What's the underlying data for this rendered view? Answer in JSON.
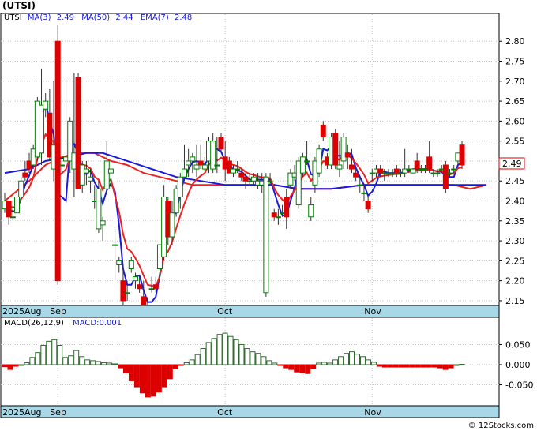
{
  "title": "(UTSI)",
  "watermark": "© 12Stocks.com",
  "legend": {
    "ticker": "UTSI",
    "ma3_label": "MA(3)",
    "ma3_value": "2.49",
    "ma50_label": "MA(50)",
    "ma50_value": "2.44",
    "ema7_label": "EMA(7)",
    "ema7_value": "2.48"
  },
  "last_price_label": "2.49",
  "macd_legend": {
    "label": "MACD(26,12,9)",
    "value_label": "MACD:0.001"
  },
  "x_labels": [
    {
      "text": "2025Aug",
      "index": 0
    },
    {
      "text": "Sep",
      "index": 13
    },
    {
      "text": "Oct",
      "index": 54
    },
    {
      "text": "Nov",
      "index": 90
    }
  ],
  "colors": {
    "up": "#008000",
    "down": "#dd0000",
    "ma_blue": "#1a1adf",
    "ma_red": "#ee2222",
    "axis_band": "#a8d8e8",
    "grid": "#c8c8c8",
    "macd_bar": "#2e6b2e"
  },
  "chart_data": {
    "type": "candlestick",
    "ylim": [
      2.14,
      2.84
    ],
    "y_ticks": [
      "2.80",
      "2.75",
      "2.70",
      "2.65",
      "2.60",
      "2.55",
      "2.50",
      "2.45",
      "2.40",
      "2.35",
      "2.30",
      "2.25",
      "2.20",
      "2.15"
    ],
    "ohlc": [
      [
        2.38,
        2.42,
        2.37,
        2.4
      ],
      [
        2.4,
        2.4,
        2.34,
        2.36
      ],
      [
        2.36,
        2.39,
        2.35,
        2.36
      ],
      [
        2.37,
        2.42,
        2.36,
        2.41
      ],
      [
        2.41,
        2.46,
        2.4,
        2.45
      ],
      [
        2.47,
        2.5,
        2.45,
        2.46
      ],
      [
        2.5,
        2.52,
        2.47,
        2.48
      ],
      [
        2.49,
        2.54,
        2.48,
        2.53
      ],
      [
        2.51,
        2.66,
        2.5,
        2.65
      ],
      [
        2.52,
        2.73,
        2.49,
        2.64
      ],
      [
        2.63,
        2.67,
        2.61,
        2.65
      ],
      [
        2.62,
        2.68,
        2.5,
        2.51
      ],
      [
        2.48,
        2.7,
        2.45,
        2.54
      ],
      [
        2.8,
        2.84,
        2.19,
        2.2
      ],
      [
        2.49,
        2.51,
        2.47,
        2.49
      ],
      [
        2.5,
        2.7,
        2.48,
        2.51
      ],
      [
        2.5,
        2.61,
        2.47,
        2.6
      ],
      [
        2.48,
        2.72,
        2.41,
        2.52
      ],
      [
        2.71,
        2.72,
        2.43,
        2.43
      ],
      [
        2.44,
        2.5,
        2.42,
        2.49
      ],
      [
        2.47,
        2.5,
        2.44,
        2.48
      ],
      [
        2.45,
        2.48,
        2.42,
        2.46
      ],
      [
        2.4,
        2.44,
        2.38,
        2.4
      ],
      [
        2.33,
        2.45,
        2.32,
        2.43
      ],
      [
        2.34,
        2.36,
        2.3,
        2.35
      ],
      [
        2.43,
        2.55,
        2.42,
        2.5
      ],
      [
        2.47,
        2.49,
        2.43,
        2.48
      ],
      [
        2.29,
        2.33,
        2.2,
        2.29
      ],
      [
        2.24,
        2.26,
        2.22,
        2.25
      ],
      [
        2.2,
        2.24,
        2.13,
        2.15
      ],
      [
        2.17,
        2.2,
        2.15,
        2.17
      ],
      [
        2.23,
        2.26,
        2.22,
        2.25
      ],
      [
        2.2,
        2.22,
        2.18,
        2.21
      ],
      [
        2.19,
        2.21,
        2.17,
        2.18
      ],
      [
        2.16,
        2.2,
        2.13,
        2.14
      ],
      [
        2.13,
        2.16,
        2.1,
        2.12
      ],
      [
        2.18,
        2.21,
        2.17,
        2.18
      ],
      [
        2.19,
        2.21,
        2.17,
        2.18
      ],
      [
        2.23,
        2.3,
        2.18,
        2.29
      ],
      [
        2.26,
        2.44,
        2.25,
        2.41
      ],
      [
        2.4,
        2.41,
        2.29,
        2.31
      ],
      [
        2.31,
        2.4,
        2.29,
        2.37
      ],
      [
        2.37,
        2.44,
        2.36,
        2.43
      ],
      [
        2.41,
        2.47,
        2.38,
        2.46
      ],
      [
        2.46,
        2.54,
        2.45,
        2.48
      ],
      [
        2.49,
        2.53,
        2.46,
        2.5
      ],
      [
        2.5,
        2.52,
        2.47,
        2.51
      ],
      [
        2.48,
        2.54,
        2.46,
        2.49
      ],
      [
        2.5,
        2.54,
        2.48,
        2.49
      ],
      [
        2.48,
        2.51,
        2.47,
        2.49
      ],
      [
        2.5,
        2.56,
        2.47,
        2.55
      ],
      [
        2.48,
        2.57,
        2.47,
        2.55
      ],
      [
        2.49,
        2.56,
        2.47,
        2.49
      ],
      [
        2.56,
        2.57,
        2.52,
        2.53
      ],
      [
        2.51,
        2.55,
        2.45,
        2.48
      ],
      [
        2.5,
        2.51,
        2.47,
        2.47
      ],
      [
        2.47,
        2.49,
        2.46,
        2.48
      ],
      [
        2.48,
        2.5,
        2.47,
        2.48
      ],
      [
        2.47,
        2.48,
        2.45,
        2.46
      ],
      [
        2.46,
        2.47,
        2.43,
        2.45
      ],
      [
        2.45,
        2.47,
        2.44,
        2.45
      ],
      [
        2.45,
        2.47,
        2.44,
        2.46
      ],
      [
        2.44,
        2.47,
        2.43,
        2.45
      ],
      [
        2.44,
        2.47,
        2.42,
        2.45
      ],
      [
        2.17,
        2.47,
        2.16,
        2.46
      ],
      [
        2.45,
        2.47,
        2.44,
        2.45
      ],
      [
        2.37,
        2.38,
        2.35,
        2.36
      ],
      [
        2.36,
        2.38,
        2.34,
        2.36
      ],
      [
        2.37,
        2.39,
        2.36,
        2.37
      ],
      [
        2.41,
        2.43,
        2.33,
        2.36
      ],
      [
        2.44,
        2.48,
        2.43,
        2.47
      ],
      [
        2.46,
        2.49,
        2.45,
        2.47
      ],
      [
        2.39,
        2.51,
        2.38,
        2.5
      ],
      [
        2.47,
        2.52,
        2.46,
        2.51
      ],
      [
        2.5,
        2.55,
        2.49,
        2.5
      ],
      [
        2.36,
        2.41,
        2.35,
        2.39
      ],
      [
        2.44,
        2.51,
        2.42,
        2.5
      ],
      [
        2.47,
        2.54,
        2.46,
        2.53
      ],
      [
        2.59,
        2.6,
        2.55,
        2.56
      ],
      [
        2.51,
        2.52,
        2.48,
        2.49
      ],
      [
        2.49,
        2.57,
        2.48,
        2.56
      ],
      [
        2.57,
        2.58,
        2.48,
        2.49
      ],
      [
        2.48,
        2.55,
        2.46,
        2.49
      ],
      [
        2.5,
        2.57,
        2.48,
        2.56
      ],
      [
        2.52,
        2.54,
        2.48,
        2.51
      ],
      [
        2.49,
        2.53,
        2.47,
        2.48
      ],
      [
        2.47,
        2.48,
        2.45,
        2.46
      ],
      [
        2.44,
        2.46,
        2.42,
        2.44
      ],
      [
        2.42,
        2.44,
        2.4,
        2.42
      ],
      [
        2.4,
        2.41,
        2.37,
        2.38
      ],
      [
        2.47,
        2.48,
        2.45,
        2.47
      ],
      [
        2.47,
        2.49,
        2.46,
        2.48
      ],
      [
        2.48,
        2.49,
        2.46,
        2.47
      ],
      [
        2.47,
        2.48,
        2.45,
        2.47
      ],
      [
        2.47,
        2.48,
        2.46,
        2.47
      ],
      [
        2.47,
        2.48,
        2.46,
        2.47
      ],
      [
        2.48,
        2.49,
        2.46,
        2.47
      ],
      [
        2.47,
        2.48,
        2.46,
        2.47
      ],
      [
        2.47,
        2.53,
        2.46,
        2.48
      ],
      [
        2.48,
        2.49,
        2.47,
        2.48
      ],
      [
        2.47,
        2.48,
        2.47,
        2.48
      ],
      [
        2.5,
        2.52,
        2.47,
        2.48
      ],
      [
        2.48,
        2.49,
        2.47,
        2.48
      ],
      [
        2.48,
        2.49,
        2.47,
        2.48
      ],
      [
        2.51,
        2.55,
        2.47,
        2.48
      ],
      [
        2.47,
        2.48,
        2.46,
        2.47
      ],
      [
        2.47,
        2.48,
        2.46,
        2.47
      ],
      [
        2.48,
        2.49,
        2.47,
        2.48
      ],
      [
        2.49,
        2.5,
        2.42,
        2.43
      ],
      [
        2.47,
        2.48,
        2.46,
        2.47
      ],
      [
        2.48,
        2.49,
        2.47,
        2.48
      ],
      [
        2.5,
        2.52,
        2.49,
        2.52
      ],
      [
        2.54,
        2.55,
        2.48,
        2.49
      ]
    ],
    "ma_blue": [
      [
        0,
        2.47
      ],
      [
        6,
        2.48
      ],
      [
        10,
        2.5
      ],
      [
        16,
        2.51
      ],
      [
        20,
        2.52
      ],
      [
        24,
        2.52
      ],
      [
        30,
        2.5
      ],
      [
        36,
        2.48
      ],
      [
        42,
        2.46
      ],
      [
        48,
        2.45
      ],
      [
        54,
        2.44
      ],
      [
        60,
        2.44
      ],
      [
        66,
        2.44
      ],
      [
        72,
        2.43
      ],
      [
        80,
        2.43
      ],
      [
        88,
        2.44
      ],
      [
        96,
        2.44
      ],
      [
        104,
        2.44
      ],
      [
        112,
        2.44
      ],
      [
        118,
        2.44
      ]
    ],
    "ema_red": [
      [
        0,
        2.4
      ],
      [
        6,
        2.45
      ],
      [
        10,
        2.49
      ],
      [
        14,
        2.51
      ],
      [
        18,
        2.52
      ],
      [
        22,
        2.52
      ],
      [
        26,
        2.5
      ],
      [
        30,
        2.49
      ],
      [
        34,
        2.47
      ],
      [
        38,
        2.46
      ],
      [
        42,
        2.45
      ],
      [
        46,
        2.44
      ],
      [
        50,
        2.44
      ],
      [
        54,
        2.44
      ],
      [
        58,
        2.44
      ],
      [
        62,
        2.44
      ],
      [
        66,
        2.44
      ],
      [
        72,
        2.43
      ],
      [
        80,
        2.43
      ],
      [
        88,
        2.44
      ],
      [
        96,
        2.44
      ],
      [
        104,
        2.44
      ],
      [
        110,
        2.44
      ],
      [
        114,
        2.43
      ],
      [
        118,
        2.44
      ]
    ],
    "macd": {
      "ylim": [
        -0.09,
        0.09
      ],
      "y_ticks": [
        "0.050",
        "0.000",
        "-0.050"
      ],
      "values": [
        -0.005,
        -0.012,
        -0.004,
        0.0,
        0.005,
        0.018,
        0.03,
        0.048,
        0.058,
        0.062,
        0.048,
        0.018,
        0.022,
        0.035,
        0.02,
        0.012,
        0.01,
        0.008,
        0.005,
        0.004,
        0.002,
        -0.008,
        -0.02,
        -0.04,
        -0.055,
        -0.07,
        -0.08,
        -0.078,
        -0.068,
        -0.055,
        -0.035,
        -0.01,
        -0.002,
        0.005,
        0.012,
        0.025,
        0.04,
        0.055,
        0.065,
        0.075,
        0.078,
        0.07,
        0.062,
        0.05,
        0.04,
        0.032,
        0.028,
        0.02,
        0.01,
        0.004,
        -0.002,
        -0.008,
        -0.012,
        -0.018,
        -0.02,
        -0.022,
        -0.01,
        0.004,
        0.006,
        0.004,
        0.012,
        0.02,
        0.028,
        0.032,
        0.026,
        0.02,
        0.012,
        0.006,
        -0.004,
        -0.006,
        -0.006,
        -0.006,
        -0.006,
        -0.006,
        -0.006,
        -0.006,
        -0.006,
        -0.006,
        -0.006,
        -0.008,
        -0.012,
        -0.008,
        0.0,
        0.001
      ]
    }
  }
}
